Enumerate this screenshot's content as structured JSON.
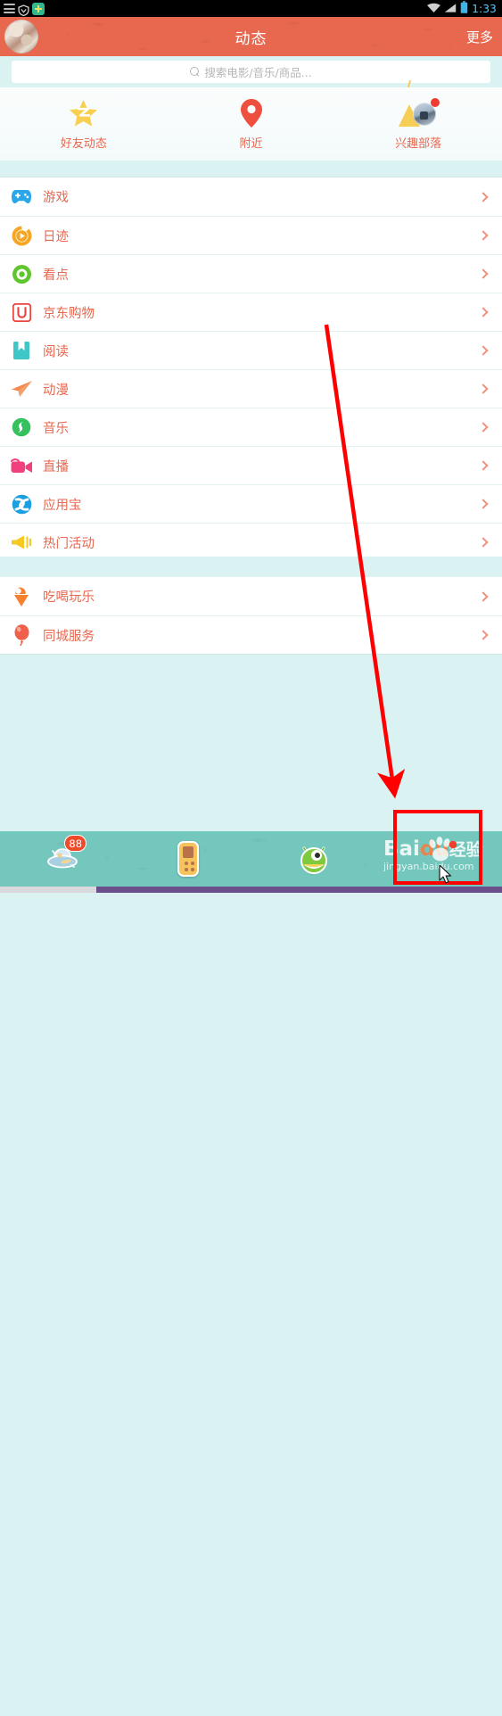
{
  "statusbar": {
    "time": "1:33",
    "left_icons": [
      "menu-lines-icon",
      "shield-icon",
      "app-tile-icon"
    ],
    "right_icons": [
      "wifi-icon",
      "signal-icon",
      "battery-icon"
    ]
  },
  "appbar": {
    "title": "动态",
    "more_label": "更多",
    "avatar_label": "avatar",
    "bg_color": "#e8674f"
  },
  "search": {
    "placeholder": "搜索电影/音乐/商品...",
    "icon": "search-icon"
  },
  "tiles": [
    {
      "label": "好友动态",
      "icon": "star-icon",
      "badge": ""
    },
    {
      "label": "附近",
      "icon": "location-pin-icon",
      "badge": ""
    },
    {
      "label": "兴趣部落",
      "icon": "tent-photo-icon",
      "badge": "dot"
    }
  ],
  "sections": [
    {
      "rows": [
        {
          "label": "游戏",
          "icon": "gamepad-icon",
          "color": "#2aa7e8"
        },
        {
          "label": "日迹",
          "icon": "play-ring-icon",
          "color": "#f5a623"
        },
        {
          "label": "看点",
          "icon": "eye-dot-icon",
          "color": "#5fc52e"
        },
        {
          "label": "京东购物",
          "icon": "jd-u-icon",
          "color": "#e8453c"
        },
        {
          "label": "阅读",
          "icon": "book-icon",
          "color": "#3fc6c6"
        },
        {
          "label": "动漫",
          "icon": "paper-plane-icon",
          "color": "#f5884a"
        },
        {
          "label": "音乐",
          "icon": "music-note-icon",
          "color": "#35c15e"
        },
        {
          "label": "直播",
          "icon": "video-camera-icon",
          "color": "#f0417e"
        },
        {
          "label": "应用宝",
          "icon": "app-treasure-icon",
          "color": "#1a9fe0"
        },
        {
          "label": "热门活动",
          "icon": "megaphone-icon",
          "color": "#f2cc22"
        }
      ]
    },
    {
      "rows": [
        {
          "label": "吃喝玩乐",
          "icon": "ice-cream-icon",
          "color": "#f5812f"
        },
        {
          "label": "同城服务",
          "icon": "balloon-icon",
          "color": "#ef5f4a"
        }
      ]
    }
  ],
  "row_chevron_icon": "chevron-right-icon",
  "tabbar": [
    {
      "icon": "ufo-icon",
      "badge": "88"
    },
    {
      "icon": "phone-icon",
      "badge": ""
    },
    {
      "icon": "monster-icon",
      "badge": ""
    },
    {
      "icon": "mascot-icon",
      "badge": "dot"
    }
  ],
  "annotations": {
    "arrow": "red-arrow",
    "highlight_box": "red-highlight-box"
  },
  "watermark": {
    "main": "Bai",
    "main_accent": "du",
    "main_tail": "经验",
    "sub": "jingyan.baidu.com"
  },
  "colors": {
    "accent": "#e8674f",
    "page_bg": "#daf2f1",
    "tabbar_bg": "#74c7bd",
    "annotation_red": "#fe0000"
  }
}
